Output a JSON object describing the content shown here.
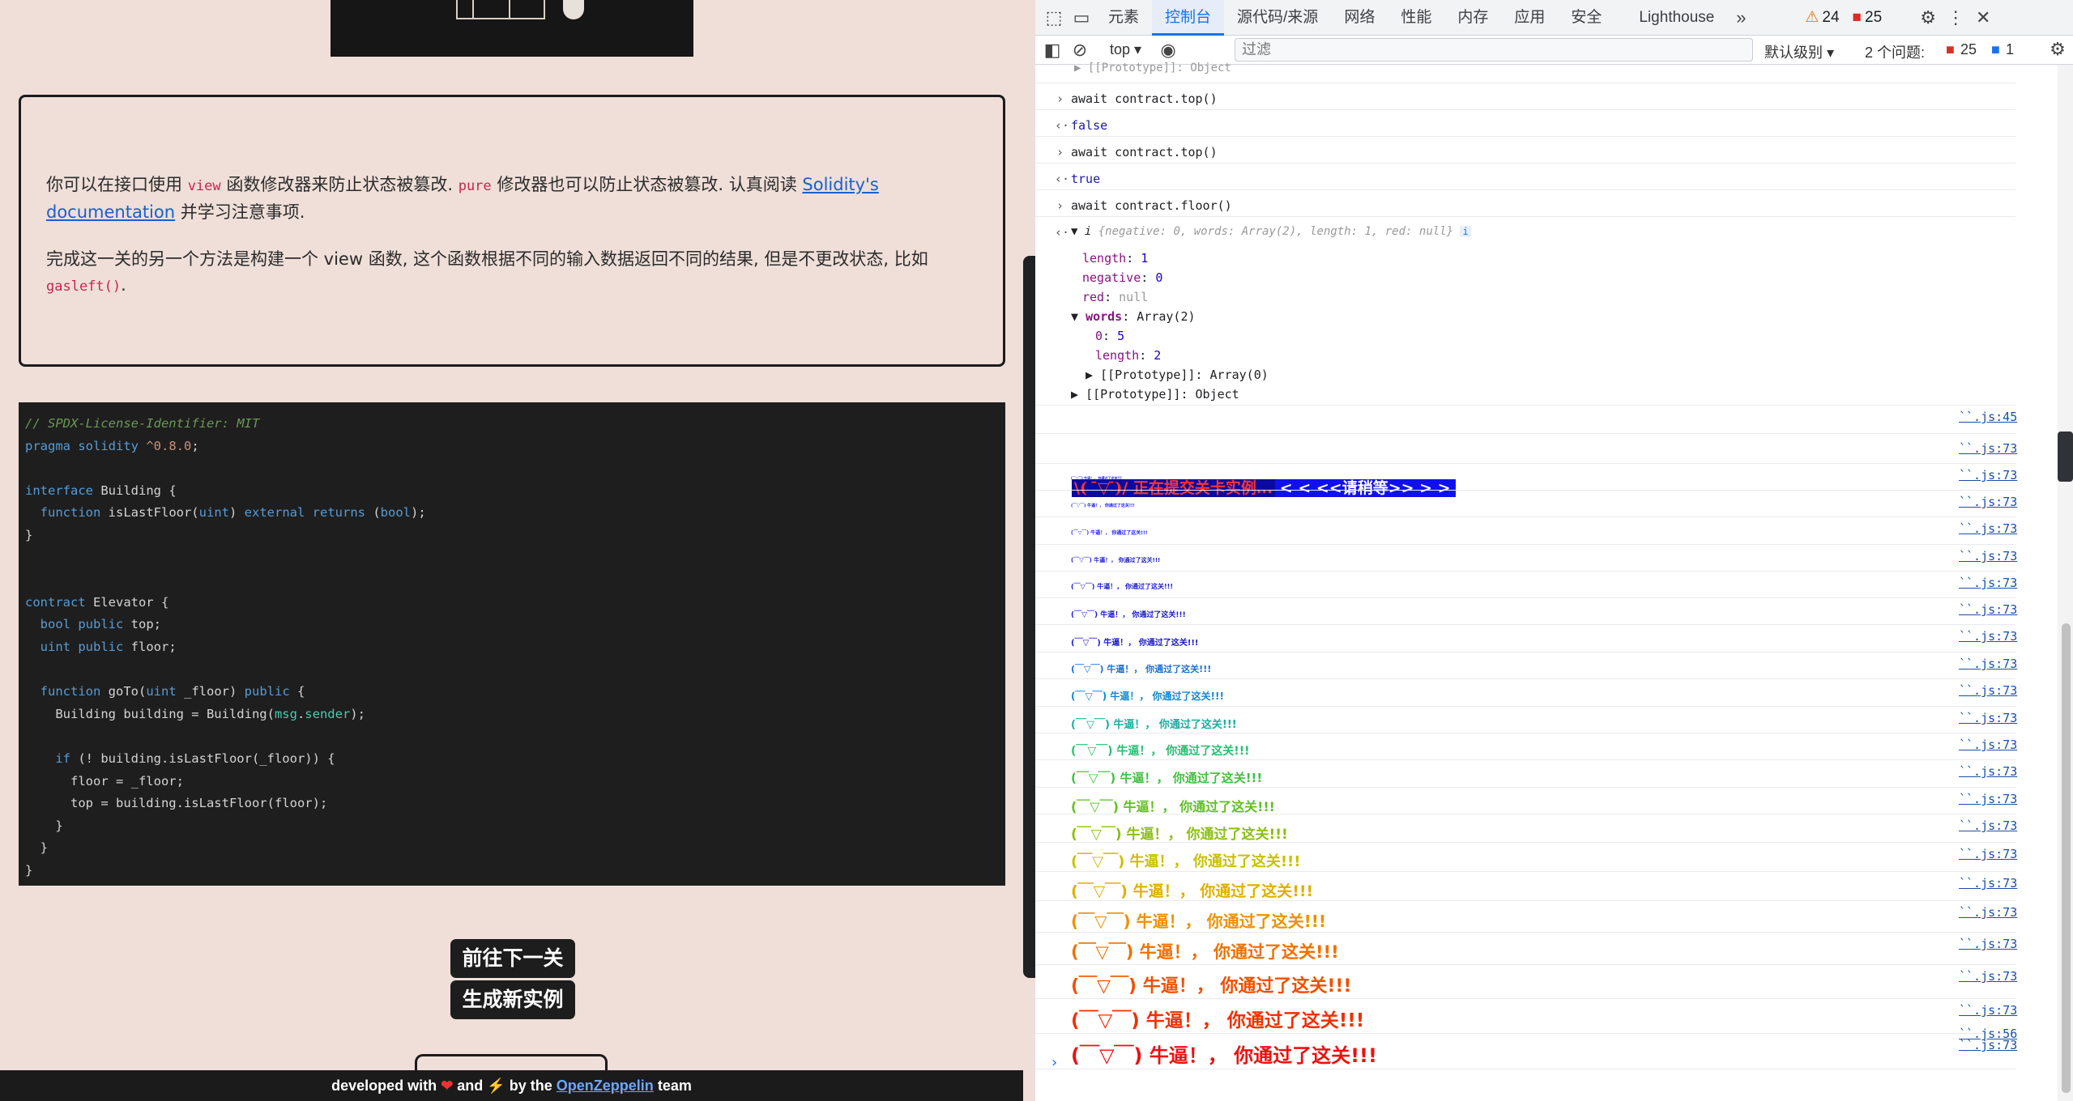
{
  "page": {
    "info_p1_pre": "你可以在接口使用",
    "info_p1_view": "view",
    "info_p1_mid": "函数修改器来防止状态被篡改.",
    "info_p1_pure": "pure",
    "info_p1_mid2": "修改器也可以防止状态被篡改. 认真阅读",
    "info_p1_link": "Solidity's documentation",
    "info_p1_post": "并学习注意事项.",
    "info_p2_pre": "完成这一关的另一个方法是构建一个 view 函数, 这个函数根据不同的输入数据返回不同的结果, 但是不更改状态, 比如",
    "info_p2_code": "gasleft()",
    "info_p2_post": ".",
    "code_lines": [
      "// SPDX-License-Identifier: MIT",
      "pragma solidity ^0.8.0;",
      "",
      "interface Building {",
      "  function isLastFloor(uint) external returns (bool);",
      "}",
      "",
      "",
      "contract Elevator {",
      "  bool public top;",
      "  uint public floor;",
      "",
      "  function goTo(uint _floor) public {",
      "    Building building = Building(msg.sender);",
      "",
      "    if (! building.isLastFloor(_floor)) {",
      "      floor = _floor;",
      "      top = building.isLastFloor(floor);",
      "    }",
      "  }",
      "}"
    ],
    "btn_next": "前往下一关",
    "btn_new": "生成新实例",
    "footer_pre": "developed with",
    "footer_and": "and",
    "footer_by": "by the",
    "footer_link": "OpenZeppelin",
    "footer_post": "team"
  },
  "devtools": {
    "tabs": [
      "元素",
      "控制台",
      "源代码/来源",
      "网络",
      "性能",
      "内存",
      "应用",
      "安全",
      "Lighthouse"
    ],
    "more": "»",
    "warn_count": "24",
    "err_count": "25",
    "context": "top",
    "filter_placeholder": "过滤",
    "level": "默认级别",
    "issues_label": "2 个问题:",
    "issues_err": "25",
    "issues_info": "1"
  },
  "console": {
    "proto_top": "[[Prototype]]: Object",
    "cmd1": "await contract.top()",
    "res1": "false",
    "cmd2": "await contract.top()",
    "res2": "true",
    "cmd3": "await contract.floor()",
    "obj_summary": "{negative: 0, words: Array(2), length: 1, red: null}",
    "obj_props": [
      {
        "k": "length",
        "v": "1"
      },
      {
        "k": "negative",
        "v": "0"
      },
      {
        "k": "red",
        "v": "null"
      }
    ],
    "words_label": "words",
    "words_type": "Array(2)",
    "words_0": "5",
    "words_len": "2",
    "proto_arr": "[[Prototype]]: Array(0)",
    "proto_obj": "[[Prototype]]: Object",
    "banner_a": "\\(  ̄▽ ̄)/ 正在提交关卡实例...",
    "banner_b": "< < <<请稍等>> > >",
    "src45": "``.js:45",
    "src73": "``.js:73",
    "src56": "``.js:56",
    "celebration": "(￣▽￣) 牛逼！， 你通过了这关!!!"
  }
}
